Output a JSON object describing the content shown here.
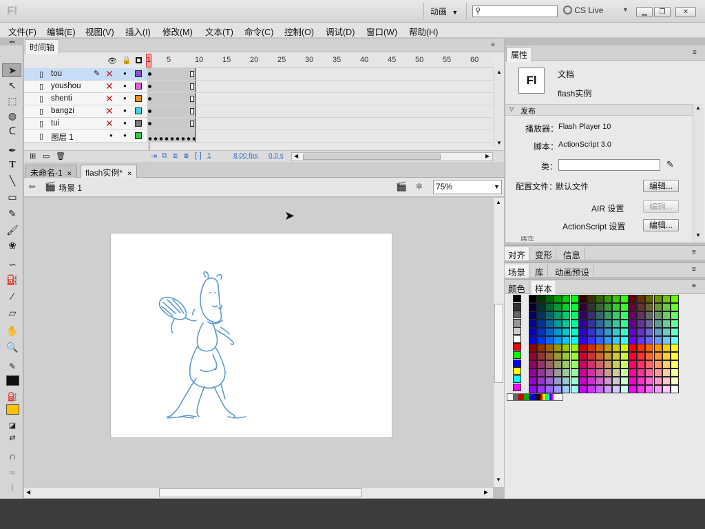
{
  "app": {
    "logo": "Fl",
    "workspace": "动画",
    "search_placeholder": "",
    "cs_live": "CS Live"
  },
  "window_buttons": {
    "minimize": "▁",
    "restore": "❐",
    "close": "✕"
  },
  "menu": [
    "文件(F)",
    "编辑(E)",
    "视图(V)",
    "插入(I)",
    "修改(M)",
    "文本(T)",
    "命令(C)",
    "控制(O)",
    "调试(D)",
    "窗口(W)",
    "帮助(H)"
  ],
  "timeline": {
    "tab": "时间轴",
    "ruler": [
      "1",
      "5",
      "10",
      "15",
      "20",
      "25",
      "30",
      "35",
      "40",
      "45",
      "50",
      "55",
      "60"
    ],
    "layers": [
      {
        "name": "tou",
        "selected": true,
        "color": "#8d4fd1"
      },
      {
        "name": "youshou",
        "selected": false,
        "color": "#e85ce1"
      },
      {
        "name": "shenti",
        "selected": false,
        "color": "#ff8c1a"
      },
      {
        "name": "bangzi",
        "selected": false,
        "color": "#39d8e8"
      },
      {
        "name": "tui",
        "selected": false,
        "color": "#7a7a7a"
      },
      {
        "name": "图层 1",
        "selected": false,
        "color": "#31c94a"
      }
    ],
    "status": {
      "frame": "1",
      "fps": "8.00 fps",
      "time": "0.0 s"
    }
  },
  "doc_tabs": [
    {
      "label": "未命名-1",
      "close": "✕",
      "active": false
    },
    {
      "label": "flash实例*",
      "close": "✕",
      "active": true
    }
  ],
  "editbar": {
    "scene": "场景 1",
    "zoom": "75%"
  },
  "properties": {
    "tab": "属性",
    "doc_icon": "Fl",
    "doc_type": "文档",
    "doc_name": "flash实例",
    "section_publish": "发布",
    "player_label": "播放器：",
    "player_value": "Flash Player 10",
    "script_label": "脚本：",
    "script_value": "ActionScript 3.0",
    "class_label": "类：",
    "class_value": "",
    "profile_label": "配置文件：",
    "profile_value": "默认文件",
    "air_label": "AIR 设置",
    "as_label": "ActionScript 设置",
    "edit_label": "编辑...",
    "section_props": "属性"
  },
  "panel_groups": [
    [
      "对齐",
      "变形",
      "信息"
    ],
    [
      "场景",
      "库",
      "动画预设"
    ],
    [
      "颜色",
      "样本"
    ]
  ],
  "colors": {
    "stroke": "#111111",
    "fill": "#ffc000",
    "accent": "#5b9bd5"
  }
}
